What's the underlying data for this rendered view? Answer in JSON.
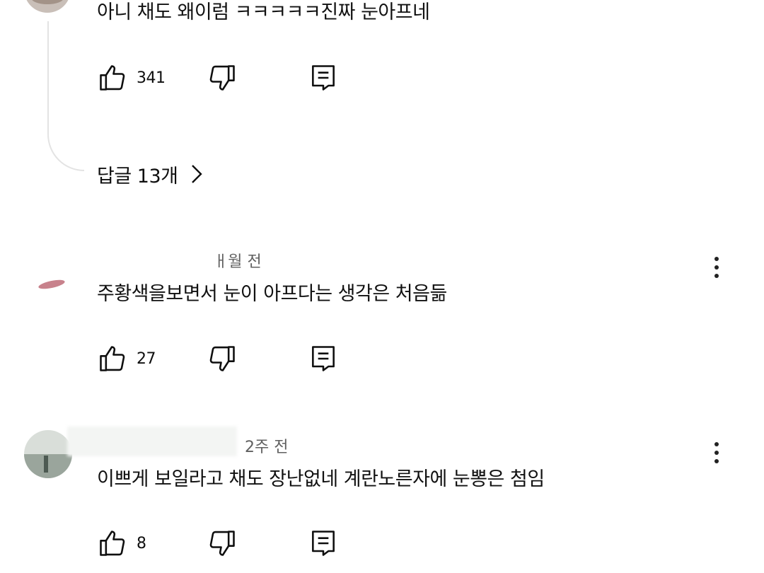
{
  "comments": [
    {
      "text": "아니 채도 왜이럼 ㅋㅋㅋㅋㅋ진짜 눈아프네",
      "likes": "341",
      "replies_label": "답글 13개"
    },
    {
      "meta": "ㅐ월 전",
      "text": "주황색을보면서 눈이 아프다는 생각은 처음듦",
      "likes": "27"
    },
    {
      "meta": "2주 전",
      "text": "이쁘게 보일라고 채도 장난없네 계란노른자에 눈뽕은 첨임",
      "likes": "8"
    }
  ],
  "icons": {
    "like": "thumbs-up-icon",
    "dislike": "thumbs-down-icon",
    "reply": "reply-icon",
    "more": "more-vert-icon",
    "chevron": "chevron-right-icon"
  }
}
